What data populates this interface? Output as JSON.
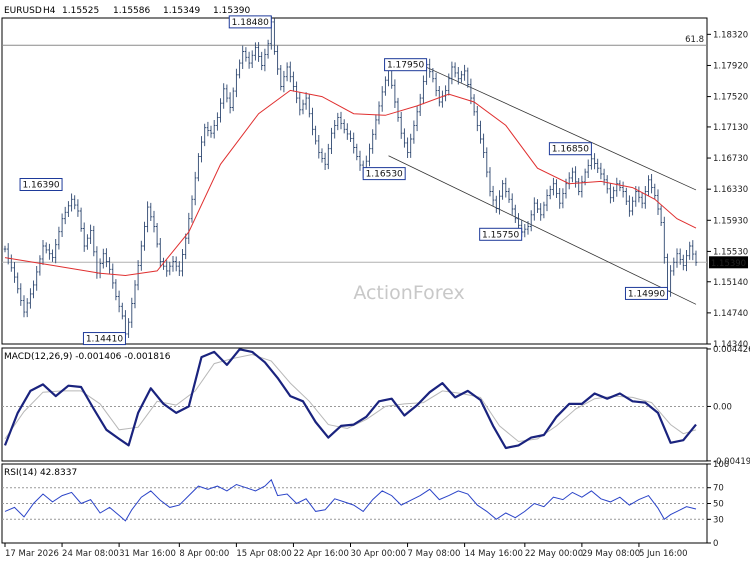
{
  "chart_data": {
    "type": "line",
    "instrument": "EURUSD",
    "timeframe": "H4",
    "ohlc": {
      "open": "1.15525",
      "high": "1.15586",
      "low": "1.15349",
      "close": "1.15390"
    },
    "watermark": "ActionForex",
    "main": {
      "y_ticks": [
        "1.18320",
        "1.17920",
        "1.17520",
        "1.17130",
        "1.16730",
        "1.16330",
        "1.15930",
        "1.15530",
        "1.15140",
        "1.14740",
        "1.14340"
      ],
      "ylim": [
        1.1434,
        1.1853
      ],
      "fib": {
        "label": "61.8",
        "value": 1.1818
      },
      "last_price": {
        "label": "1.15390",
        "value": 1.1539
      },
      "price": [
        [
          0,
          1.1556
        ],
        [
          3,
          1.152
        ],
        [
          6,
          1.1475
        ],
        [
          9,
          1.151
        ],
        [
          12,
          1.156
        ],
        [
          15,
          1.1545
        ],
        [
          18,
          1.1595
        ],
        [
          21,
          1.162
        ],
        [
          23,
          1.1605
        ],
        [
          25,
          1.156
        ],
        [
          27,
          1.158
        ],
        [
          29,
          1.1525
        ],
        [
          31,
          1.155
        ],
        [
          33,
          1.153
        ],
        [
          35,
          1.1495
        ],
        [
          37,
          1.147
        ],
        [
          38,
          1.1447
        ],
        [
          39,
          1.1462
        ],
        [
          41,
          1.151
        ],
        [
          43,
          1.156
        ],
        [
          45,
          1.161
        ],
        [
          47,
          1.1585
        ],
        [
          49,
          1.154
        ],
        [
          51,
          1.1528
        ],
        [
          53,
          1.154
        ],
        [
          55,
          1.1528
        ],
        [
          57,
          1.157
        ],
        [
          59,
          1.162
        ],
        [
          61,
          1.1675
        ],
        [
          63,
          1.1712
        ],
        [
          65,
          1.1705
        ],
        [
          67,
          1.1725
        ],
        [
          69,
          1.1762
        ],
        [
          71,
          1.1738
        ],
        [
          73,
          1.178
        ],
        [
          75,
          1.181
        ],
        [
          77,
          1.1795
        ],
        [
          79,
          1.1815
        ],
        [
          81,
          1.1792
        ],
        [
          83,
          1.182
        ],
        [
          84,
          1.1848
        ],
        [
          85,
          1.181
        ],
        [
          87,
          1.1765
        ],
        [
          89,
          1.179
        ],
        [
          91,
          1.1765
        ],
        [
          93,
          1.1735
        ],
        [
          95,
          1.175
        ],
        [
          97,
          1.171
        ],
        [
          99,
          1.168
        ],
        [
          101,
          1.1665
        ],
        [
          103,
          1.1705
        ],
        [
          105,
          1.1725
        ],
        [
          107,
          1.171
        ],
        [
          109,
          1.1698
        ],
        [
          111,
          1.1675
        ],
        [
          113,
          1.1653
        ],
        [
          115,
          1.1685
        ],
        [
          117,
          1.1722
        ],
        [
          119,
          1.1758
        ],
        [
          121,
          1.1788
        ],
        [
          123,
          1.1745
        ],
        [
          125,
          1.1705
        ],
        [
          127,
          1.168
        ],
        [
          129,
          1.1715
        ],
        [
          131,
          1.175
        ],
        [
          133,
          1.1793
        ],
        [
          135,
          1.1775
        ],
        [
          137,
          1.1745
        ],
        [
          139,
          1.176
        ],
        [
          141,
          1.179
        ],
        [
          143,
          1.1775
        ],
        [
          145,
          1.1785
        ],
        [
          147,
          1.175
        ],
        [
          149,
          1.1715
        ],
        [
          151,
          1.168
        ],
        [
          153,
          1.163
        ],
        [
          155,
          1.1608
        ],
        [
          157,
          1.164
        ],
        [
          159,
          1.162
        ],
        [
          161,
          1.1595
        ],
        [
          163,
          1.1578
        ],
        [
          165,
          1.1585
        ],
        [
          167,
          1.1615
        ],
        [
          169,
          1.16
        ],
        [
          171,
          1.1625
        ],
        [
          173,
          1.164
        ],
        [
          175,
          1.1615
        ],
        [
          177,
          1.164
        ],
        [
          179,
          1.1655
        ],
        [
          181,
          1.163
        ],
        [
          183,
          1.1655
        ],
        [
          185,
          1.1672
        ],
        [
          187,
          1.166
        ],
        [
          189,
          1.1645
        ],
        [
          191,
          1.1622
        ],
        [
          193,
          1.164
        ],
        [
          195,
          1.163
        ],
        [
          197,
          1.1605
        ],
        [
          199,
          1.163
        ],
        [
          201,
          1.1615
        ],
        [
          203,
          1.1645
        ],
        [
          205,
          1.1625
        ],
        [
          207,
          1.159
        ],
        [
          208,
          1.1545
        ],
        [
          209,
          1.1502
        ],
        [
          210,
          1.1528
        ],
        [
          212,
          1.155
        ],
        [
          214,
          1.1535
        ],
        [
          216,
          1.156
        ],
        [
          218,
          1.1539
        ]
      ],
      "ma": [
        [
          0,
          1.1545
        ],
        [
          15,
          1.1535
        ],
        [
          30,
          1.1525
        ],
        [
          38,
          1.1522
        ],
        [
          48,
          1.1528
        ],
        [
          58,
          1.1578
        ],
        [
          68,
          1.1665
        ],
        [
          80,
          1.173
        ],
        [
          90,
          1.176
        ],
        [
          100,
          1.1752
        ],
        [
          110,
          1.173
        ],
        [
          120,
          1.1728
        ],
        [
          130,
          1.174
        ],
        [
          140,
          1.1755
        ],
        [
          148,
          1.1745
        ],
        [
          158,
          1.1715
        ],
        [
          168,
          1.166
        ],
        [
          178,
          1.164
        ],
        [
          188,
          1.1643
        ],
        [
          198,
          1.1635
        ],
        [
          205,
          1.162
        ],
        [
          212,
          1.1595
        ],
        [
          218,
          1.1583
        ]
      ],
      "channel_upper": [
        [
          129,
          1.1797
        ],
        [
          218,
          1.1632
        ]
      ],
      "channel_lower": [
        [
          121,
          1.1676
        ],
        [
          218,
          1.1485
        ]
      ],
      "labels": [
        {
          "text": "1.18480",
          "i": 84,
          "v": 1.1848,
          "side": "left"
        },
        {
          "text": "1.17950",
          "i": 133,
          "v": 1.1793,
          "side": "left"
        },
        {
          "text": "1.16390",
          "i": 18,
          "v": 1.1639,
          "side": "left"
        },
        {
          "text": "1.16530",
          "i": 113,
          "v": 1.1653,
          "side": "right"
        },
        {
          "text": "1.16850",
          "i": 185,
          "v": 1.1685,
          "side": "left"
        },
        {
          "text": "1.15750",
          "i": 163,
          "v": 1.1575,
          "side": "left"
        },
        {
          "text": "1.14990",
          "i": 209,
          "v": 1.1499,
          "side": "left"
        },
        {
          "text": "1.14410",
          "i": 38,
          "v": 1.1441,
          "side": "left"
        }
      ]
    },
    "macd": {
      "label": "MACD(12,26,9) -0.001406 -0.001816",
      "y_ticks": [
        "0.004426",
        "0.00",
        "-0.004192"
      ],
      "ylim": [
        -0.0042,
        0.0045
      ],
      "macd": [
        [
          0,
          -0.003
        ],
        [
          4,
          -0.0005
        ],
        [
          8,
          0.0012
        ],
        [
          12,
          0.0017
        ],
        [
          16,
          0.0008
        ],
        [
          20,
          0.0016
        ],
        [
          24,
          0.0015
        ],
        [
          28,
          -0.0002
        ],
        [
          32,
          -0.0018
        ],
        [
          36,
          -0.0025
        ],
        [
          39,
          -0.003
        ],
        [
          42,
          -0.0005
        ],
        [
          46,
          0.0014
        ],
        [
          50,
          0.0002
        ],
        [
          54,
          -0.0005
        ],
        [
          58,
          0.0
        ],
        [
          62,
          0.0038
        ],
        [
          66,
          0.0042
        ],
        [
          70,
          0.0032
        ],
        [
          74,
          0.0044
        ],
        [
          78,
          0.0042
        ],
        [
          82,
          0.0034
        ],
        [
          86,
          0.0022
        ],
        [
          90,
          0.0008
        ],
        [
          94,
          0.0004
        ],
        [
          98,
          -0.0012
        ],
        [
          102,
          -0.0024
        ],
        [
          106,
          -0.0015
        ],
        [
          110,
          -0.0014
        ],
        [
          114,
          -0.0008
        ],
        [
          118,
          0.0004
        ],
        [
          122,
          0.0006
        ],
        [
          126,
          -0.0007
        ],
        [
          130,
          0.0001
        ],
        [
          134,
          0.0011
        ],
        [
          138,
          0.0018
        ],
        [
          142,
          0.0007
        ],
        [
          146,
          0.0012
        ],
        [
          150,
          0.0005
        ],
        [
          154,
          -0.0015
        ],
        [
          158,
          -0.0032
        ],
        [
          162,
          -0.003
        ],
        [
          166,
          -0.0024
        ],
        [
          170,
          -0.0022
        ],
        [
          174,
          -0.0008
        ],
        [
          178,
          0.0002
        ],
        [
          182,
          0.0002
        ],
        [
          186,
          0.001
        ],
        [
          190,
          0.0006
        ],
        [
          194,
          0.001
        ],
        [
          198,
          0.0004
        ],
        [
          202,
          0.0003
        ],
        [
          206,
          -0.0005
        ],
        [
          210,
          -0.0028
        ],
        [
          214,
          -0.0026
        ],
        [
          218,
          -0.0014
        ]
      ],
      "signal": [
        [
          0,
          -0.0025
        ],
        [
          6,
          -0.0004
        ],
        [
          12,
          0.0011
        ],
        [
          18,
          0.0012
        ],
        [
          24,
          0.0012
        ],
        [
          30,
          0.0002
        ],
        [
          36,
          -0.0018
        ],
        [
          42,
          -0.0016
        ],
        [
          48,
          0.0004
        ],
        [
          54,
          0.0001
        ],
        [
          60,
          0.0012
        ],
        [
          66,
          0.0033
        ],
        [
          72,
          0.0037
        ],
        [
          78,
          0.004
        ],
        [
          84,
          0.0035
        ],
        [
          90,
          0.0018
        ],
        [
          96,
          0.0004
        ],
        [
          102,
          -0.0014
        ],
        [
          108,
          -0.0017
        ],
        [
          114,
          -0.001
        ],
        [
          120,
          0.0
        ],
        [
          126,
          0.0002
        ],
        [
          132,
          0.0003
        ],
        [
          138,
          0.0012
        ],
        [
          144,
          0.001
        ],
        [
          150,
          0.0007
        ],
        [
          156,
          -0.0015
        ],
        [
          162,
          -0.0027
        ],
        [
          168,
          -0.0025
        ],
        [
          174,
          -0.0015
        ],
        [
          180,
          -0.0002
        ],
        [
          186,
          0.0006
        ],
        [
          192,
          0.0008
        ],
        [
          198,
          0.0007
        ],
        [
          204,
          0.0003
        ],
        [
          210,
          -0.0014
        ],
        [
          214,
          -0.0021
        ],
        [
          218,
          -0.0018
        ]
      ]
    },
    "rsi": {
      "label": "RSI(14) 42.8337",
      "y_ticks": [
        "100",
        "70",
        "50",
        "30",
        "0"
      ],
      "ylim": [
        0,
        100
      ],
      "levels": [
        70,
        50,
        30
      ],
      "values": [
        [
          0,
          40
        ],
        [
          3,
          45
        ],
        [
          6,
          33
        ],
        [
          9,
          50
        ],
        [
          12,
          62
        ],
        [
          15,
          52
        ],
        [
          18,
          60
        ],
        [
          21,
          64
        ],
        [
          24,
          50
        ],
        [
          27,
          55
        ],
        [
          30,
          38
        ],
        [
          33,
          45
        ],
        [
          36,
          35
        ],
        [
          38,
          28
        ],
        [
          40,
          42
        ],
        [
          43,
          58
        ],
        [
          46,
          66
        ],
        [
          49,
          54
        ],
        [
          52,
          45
        ],
        [
          55,
          48
        ],
        [
          58,
          60
        ],
        [
          61,
          72
        ],
        [
          64,
          68
        ],
        [
          67,
          72
        ],
        [
          70,
          66
        ],
        [
          73,
          74
        ],
        [
          76,
          70
        ],
        [
          79,
          66
        ],
        [
          82,
          72
        ],
        [
          84,
          80
        ],
        [
          86,
          60
        ],
        [
          89,
          62
        ],
        [
          92,
          50
        ],
        [
          95,
          56
        ],
        [
          98,
          40
        ],
        [
          101,
          42
        ],
        [
          104,
          56
        ],
        [
          107,
          52
        ],
        [
          110,
          48
        ],
        [
          113,
          40
        ],
        [
          116,
          55
        ],
        [
          119,
          66
        ],
        [
          122,
          60
        ],
        [
          125,
          48
        ],
        [
          128,
          54
        ],
        [
          131,
          60
        ],
        [
          134,
          68
        ],
        [
          137,
          55
        ],
        [
          140,
          60
        ],
        [
          143,
          66
        ],
        [
          146,
          62
        ],
        [
          149,
          48
        ],
        [
          152,
          40
        ],
        [
          155,
          30
        ],
        [
          158,
          38
        ],
        [
          161,
          32
        ],
        [
          164,
          40
        ],
        [
          167,
          50
        ],
        [
          170,
          46
        ],
        [
          173,
          58
        ],
        [
          176,
          55
        ],
        [
          179,
          64
        ],
        [
          182,
          58
        ],
        [
          185,
          66
        ],
        [
          188,
          56
        ],
        [
          191,
          52
        ],
        [
          194,
          58
        ],
        [
          197,
          48
        ],
        [
          200,
          55
        ],
        [
          203,
          60
        ],
        [
          206,
          44
        ],
        [
          208,
          30
        ],
        [
          210,
          36
        ],
        [
          212,
          40
        ],
        [
          215,
          46
        ],
        [
          218,
          43
        ]
      ]
    },
    "x_ticks": [
      {
        "i": 0,
        "label": "17 Mar 2026"
      },
      {
        "i": 18,
        "label": "24 Mar 08:00"
      },
      {
        "i": 36,
        "label": "31 Mar 16:00"
      },
      {
        "i": 55,
        "label": "8 Apr 00:00"
      },
      {
        "i": 73,
        "label": "15 Apr 08:00"
      },
      {
        "i": 91,
        "label": "22 Apr 16:00"
      },
      {
        "i": 109,
        "label": "30 Apr 00:00"
      },
      {
        "i": 127,
        "label": "7 May 08:00"
      },
      {
        "i": 145,
        "label": "14 May 16:00"
      },
      {
        "i": 164,
        "label": "22 May 00:00"
      },
      {
        "i": 182,
        "label": "29 May 08:00"
      },
      {
        "i": 200,
        "label": "5 Jun 16:00"
      }
    ]
  }
}
